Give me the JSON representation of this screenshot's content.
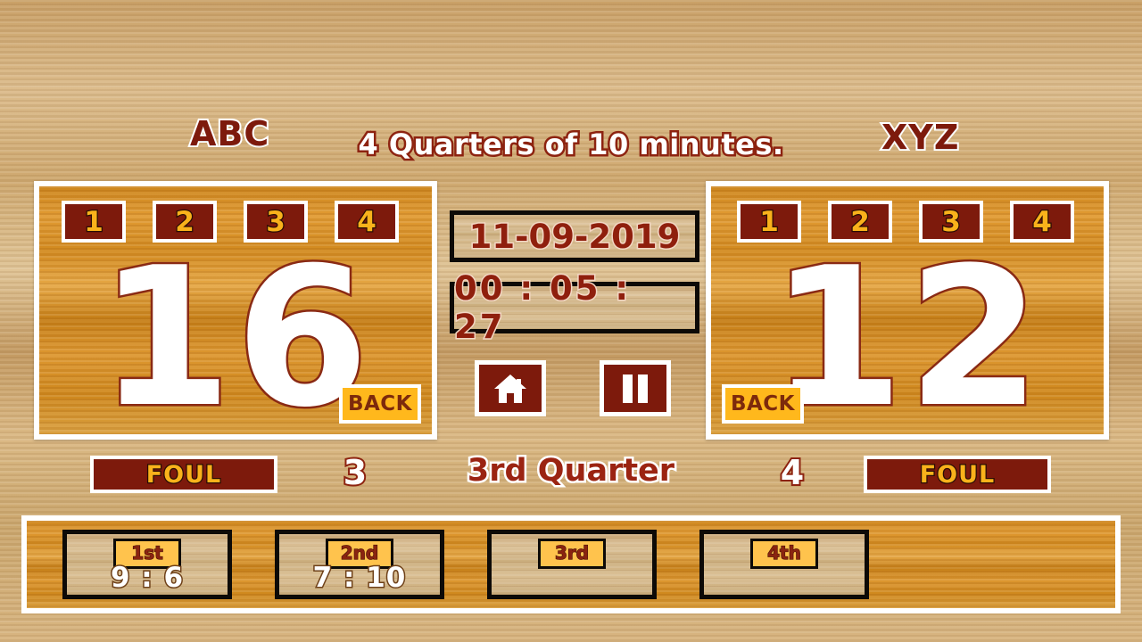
{
  "app": {
    "match_title": "4 Quarters of 10 minutes."
  },
  "colors": {
    "dark_red": "#7d1a0c",
    "gold": "#f9b21b",
    "amber": "#ffb81c",
    "white": "#ffffff",
    "wood_light": "#d3ab74",
    "wood_orange": "#d98e22"
  },
  "teams": {
    "left": {
      "name": "ABC",
      "score": "16",
      "point_buttons": [
        "1",
        "2",
        "3",
        "4"
      ],
      "back_label": "BACK",
      "foul_label": "FOUL",
      "foul_count": "3"
    },
    "right": {
      "name": "XYZ",
      "score": "12",
      "point_buttons": [
        "1",
        "2",
        "3",
        "4"
      ],
      "back_label": "BACK",
      "foul_label": "FOUL",
      "foul_count": "4"
    }
  },
  "center": {
    "date": "11-09-2019",
    "clock": "00 : 05 : 27",
    "home_icon": "home-icon",
    "pause_icon": "pause-icon"
  },
  "status": {
    "current_quarter": "3rd Quarter"
  },
  "quarters": [
    {
      "label": "1st",
      "score": "9 : 6"
    },
    {
      "label": "2nd",
      "score": "7 : 10"
    },
    {
      "label": "3rd",
      "score": ""
    },
    {
      "label": "4th",
      "score": ""
    }
  ]
}
